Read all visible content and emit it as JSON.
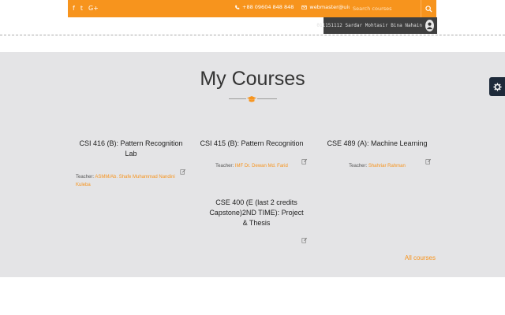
{
  "topbar": {
    "social": [
      {
        "icon": "facebook-icon",
        "glyph": "f"
      },
      {
        "icon": "twitter-icon",
        "glyph": "t"
      },
      {
        "icon": "google-plus-icon",
        "glyph": "G+"
      }
    ],
    "phone": "+88 09604 848 848",
    "email": "webmaster@uiu.ac.bd",
    "search_placeholder": "Search courses"
  },
  "user": {
    "name": "011151112 Sardar Mohtasir Bina Nahain"
  },
  "main": {
    "title": "My Courses",
    "all_courses_label": "All courses",
    "courses": [
      {
        "title": "CSI 416 (B): Pattern Recognition Lab",
        "teacher_label": "Teacher:",
        "teacher_name": "ASMM/Ab. Shafe Muhammad Nandini Kuleba"
      },
      {
        "title": "CSI 415 (B): Pattern Recognition",
        "teacher_label": "Teacher:",
        "teacher_name": "IMF Dr. Dewan Md. Farid"
      },
      {
        "title": "CSE 489 (A): Machine Learning",
        "teacher_label": "Teacher:",
        "teacher_name": "Shahriar Rahman"
      },
      {
        "title": "CSE 400 (E (last 2 credits Capstone)2ND TIME): Project & Thesis",
        "teacher_label": "",
        "teacher_name": ""
      }
    ]
  },
  "colors": {
    "accent": "#f7941d",
    "background": "#e4e4e6",
    "dark": "#3f3f3f"
  }
}
